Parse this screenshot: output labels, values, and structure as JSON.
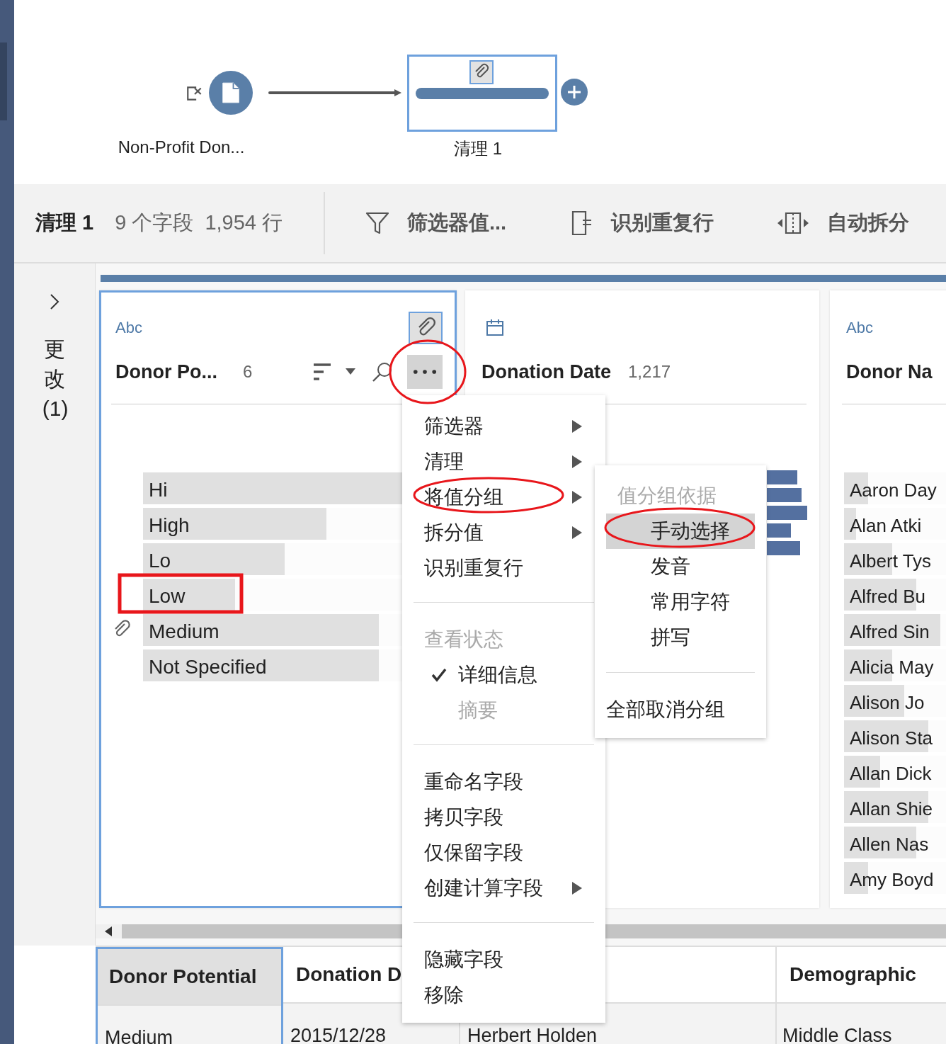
{
  "flow": {
    "nodes": [
      {
        "kind": "input",
        "label": "Non-Profit Don...",
        "selected": false
      },
      {
        "kind": "clean",
        "label": "清理 1",
        "selected": true
      }
    ]
  },
  "toolbar": {
    "title": "清理 1",
    "field_count": "9 个字段",
    "row_count": "1,954 行",
    "actions": [
      {
        "kind": "filter",
        "label": "筛选器值..."
      },
      {
        "kind": "duplicates",
        "label": "识别重复行"
      },
      {
        "kind": "split",
        "label": "自动拆分"
      }
    ]
  },
  "changes_pane": {
    "label": "更改(1)",
    "expanded": false
  },
  "profile": {
    "cards": [
      {
        "kind": "text",
        "type_label": "Abc",
        "name": "Donor Po...",
        "count": "6",
        "selected": true,
        "grouped": true,
        "menu_open": true,
        "values": [
          {
            "label": "Hi",
            "level": 1.0,
            "grouped": false
          },
          {
            "label": "High",
            "level": 0.7,
            "grouped": false
          },
          {
            "label": "Lo",
            "level": 0.54,
            "grouped": false
          },
          {
            "label": "Low",
            "level": 0.35,
            "grouped": false
          },
          {
            "label": "Medium",
            "level": 0.9,
            "grouped": true
          },
          {
            "label": "Not Specified",
            "level": 0.9,
            "grouped": false
          }
        ]
      },
      {
        "kind": "date",
        "name": "Donation Date",
        "count": "1,217",
        "selected": false,
        "grouped": false
      },
      {
        "kind": "text",
        "type_label": "Abc",
        "name": "Donor Na",
        "selected": false,
        "grouped": false,
        "values": [
          {
            "label": "Aaron Day",
            "level": 0.2,
            "grouped": false
          },
          {
            "label": "Alan Atki",
            "level": 0.1,
            "grouped": false
          },
          {
            "label": "Albert Tys",
            "level": 0.4,
            "grouped": false
          },
          {
            "label": "Alfred Bu",
            "level": 0.6,
            "grouped": false
          },
          {
            "label": "Alfred Sin",
            "level": 0.8,
            "grouped": false
          },
          {
            "label": "Alicia May",
            "level": 0.4,
            "grouped": false
          },
          {
            "label": "Alison Jo",
            "level": 0.5,
            "grouped": false
          },
          {
            "label": "Alison Sta",
            "level": 0.7,
            "grouped": false
          },
          {
            "label": "Allan Dick",
            "level": 0.3,
            "grouped": false
          },
          {
            "label": "Allan Shie",
            "level": 0.7,
            "grouped": false
          },
          {
            "label": "Allen Nas",
            "level": 0.6,
            "grouped": false
          },
          {
            "label": "Amy Boyd",
            "level": 0.2,
            "grouped": false
          }
        ]
      }
    ]
  },
  "grid": {
    "columns": [
      {
        "name": "Donor Potential",
        "selected": true
      },
      {
        "name": "Donation D",
        "selected": false
      },
      {
        "selected": false
      },
      {
        "name": "Demographic",
        "selected": false
      }
    ],
    "rows": [
      [
        "Medium",
        "2015/12/28",
        "Herbert Holden",
        "Middle Class"
      ]
    ]
  },
  "context_menu": {
    "groups": [
      {
        "items": [
          {
            "kind": "submenu",
            "label": "筛选器"
          },
          {
            "kind": "submenu",
            "label": "清理"
          },
          {
            "kind": "submenu",
            "label": "将值分组"
          },
          {
            "kind": "submenu",
            "label": "拆分值"
          },
          {
            "kind": "action",
            "label": "识别重复行"
          }
        ]
      },
      {
        "header": "查看状态",
        "items": [
          {
            "kind": "check",
            "label": "详细信息",
            "checked": true,
            "disabled": false
          },
          {
            "kind": "check",
            "label": "摘要",
            "checked": false,
            "disabled": true
          }
        ]
      },
      {
        "items": [
          {
            "kind": "action",
            "label": "重命名字段"
          },
          {
            "kind": "action",
            "label": "拷贝字段"
          },
          {
            "kind": "action",
            "label": "仅保留字段"
          },
          {
            "kind": "submenu",
            "label": "创建计算字段"
          }
        ]
      },
      {
        "items": [
          {
            "kind": "action",
            "label": "隐藏字段"
          },
          {
            "kind": "action",
            "label": "移除"
          }
        ]
      }
    ]
  },
  "submenu": {
    "header": "值分组依据",
    "items": [
      {
        "label": "手动选择",
        "selected": true
      },
      {
        "label": "发音",
        "selected": false
      },
      {
        "label": "常用字符",
        "selected": false
      },
      {
        "label": "拼写",
        "selected": false
      }
    ],
    "actions": [
      {
        "label": "全部取消分组"
      }
    ]
  }
}
